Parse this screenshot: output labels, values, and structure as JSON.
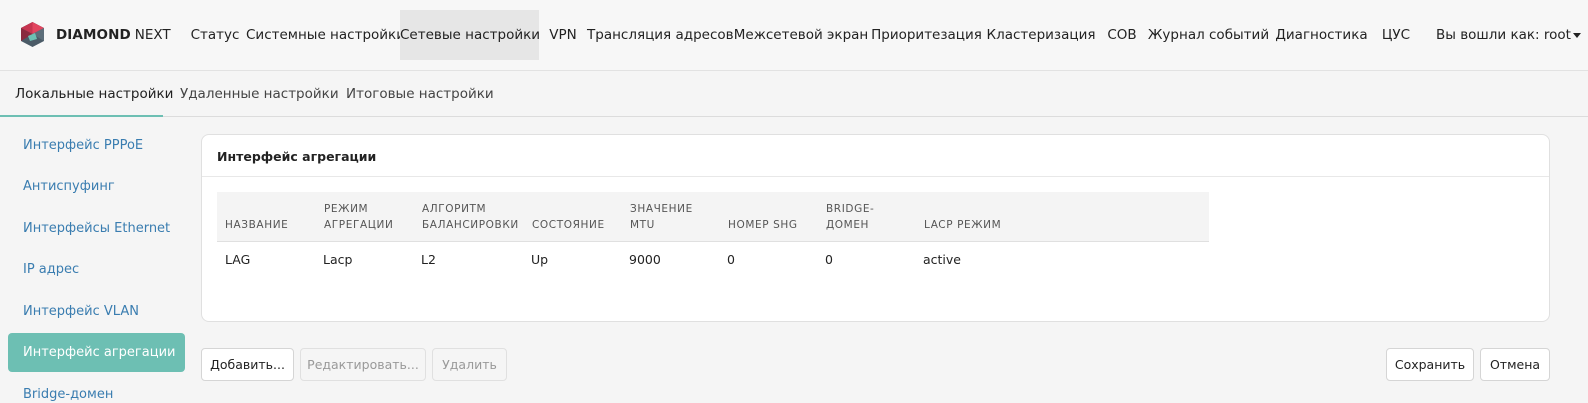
{
  "app": {
    "brand_bold": "DIAMOND",
    "brand_light": "NEXT",
    "accent_color": "#6dbfb3",
    "logo_colors": [
      "#e2455f",
      "#8a2a3e",
      "#4b5b67",
      "#6dbfb3"
    ]
  },
  "nav": {
    "items": [
      {
        "label": "Статус"
      },
      {
        "label": "Системные настройки"
      },
      {
        "label": "Сетевые настройки",
        "active": true
      },
      {
        "label": "VPN"
      },
      {
        "label": "Трансляция адресов"
      },
      {
        "label": "Межсетевой экран"
      },
      {
        "label": "Приоритезация"
      },
      {
        "label": "Кластеризация"
      },
      {
        "label": "СОВ"
      },
      {
        "label": "Журнал событий"
      },
      {
        "label": "Диагностика"
      },
      {
        "label": "ЦУС"
      }
    ],
    "user_label": "Вы вошли как: root"
  },
  "subtabs": [
    {
      "label": "Локальные настройки",
      "active": true
    },
    {
      "label": "Удаленные настройки"
    },
    {
      "label": "Итоговые настройки"
    }
  ],
  "sidebar": {
    "items": [
      {
        "label": "Интерфейс PPPoE"
      },
      {
        "label": "Антиспуфинг"
      },
      {
        "label": "Интерфейсы Ethernet"
      },
      {
        "label": "IP адрес"
      },
      {
        "label": "Интерфейс VLAN"
      },
      {
        "label": "Интерфейс агрегации",
        "active": true
      },
      {
        "label": "Bridge-домен"
      }
    ]
  },
  "panel": {
    "title": "Интерфейс агрегации",
    "columns": [
      {
        "l1": "",
        "l2": "НАЗВАНИЕ"
      },
      {
        "l1": "РЕЖИМ",
        "l2": "АГРЕГАЦИИ"
      },
      {
        "l1": "АЛГОРИТМ",
        "l2": "БАЛАНСИРОВКИ"
      },
      {
        "l1": "",
        "l2": "СОСТОЯНИЕ"
      },
      {
        "l1": "ЗНАЧЕНИЕ",
        "l2": "MTU"
      },
      {
        "l1": "",
        "l2": "НОМЕР SHG"
      },
      {
        "l1": "BRIDGE-",
        "l2": "ДОМЕН"
      },
      {
        "l1": "",
        "l2": "LACP РЕЖИМ"
      }
    ],
    "rows": [
      [
        "LAG",
        "Lacp",
        "L2",
        "Up",
        "9000",
        "0",
        "0",
        "active"
      ]
    ]
  },
  "actions": {
    "add": "Добавить...",
    "edit": "Редактировать...",
    "delete": "Удалить",
    "save": "Сохранить",
    "cancel": "Отмена"
  }
}
